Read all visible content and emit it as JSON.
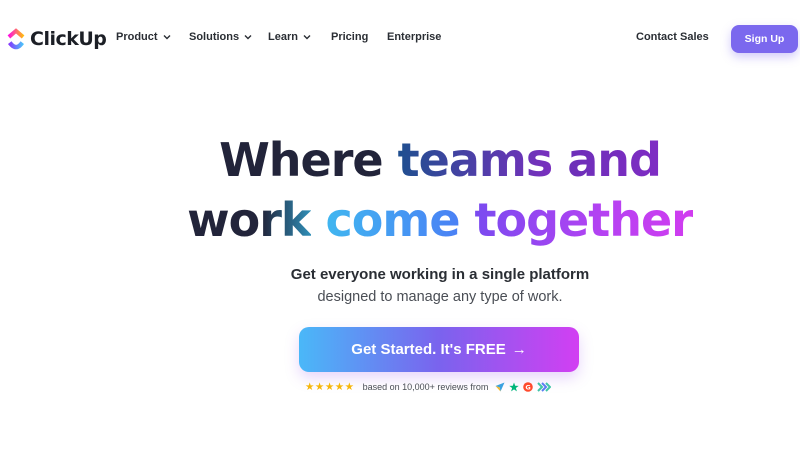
{
  "brand": {
    "name": "ClickUp"
  },
  "nav": {
    "items": [
      {
        "label": "Product",
        "has_dropdown": true
      },
      {
        "label": "Solutions",
        "has_dropdown": true
      },
      {
        "label": "Learn",
        "has_dropdown": true
      },
      {
        "label": "Pricing",
        "has_dropdown": false
      },
      {
        "label": "Enterprise",
        "has_dropdown": false
      }
    ],
    "contact_label": "Contact Sales",
    "signup_label": "Sign Up"
  },
  "hero": {
    "line1": [
      "Where",
      "teams",
      "and"
    ],
    "line2": [
      "work",
      "come",
      "together"
    ],
    "subtitle_bold": "Get everyone working in a single platform",
    "subtitle": "designed to manage any type of work.",
    "cta_label": "Get Started. It's FREE",
    "cta_arrow": "→"
  },
  "reviews": {
    "stars": "★★★★★",
    "rating_count": 5,
    "text": "based on 10,000+ reviews from",
    "sources": [
      "capterra-icon",
      "trustpilot-icon",
      "g2-icon",
      "getapp-icon"
    ]
  },
  "colors": {
    "accent": "#7b68ee",
    "star": "#f6b60a",
    "text_dark": "#22243a"
  }
}
